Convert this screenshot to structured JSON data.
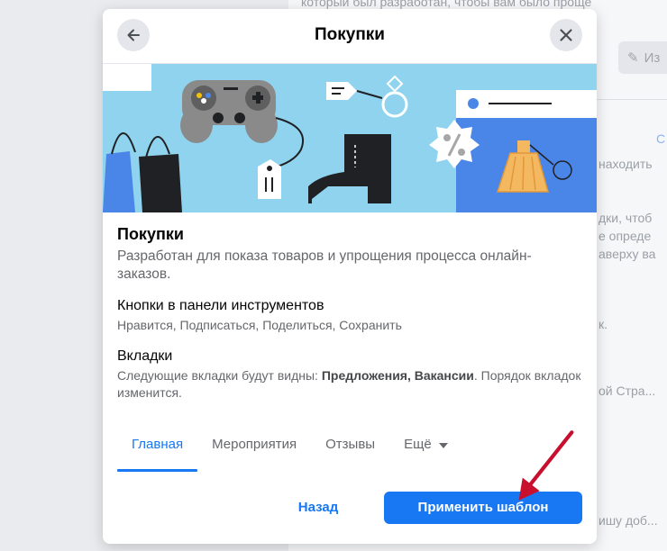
{
  "background": {
    "snippets": [
      "который был разработан, чтобы вам было проще",
      "Из",
      "С",
      "находить",
      "дки, чтоб",
      "е опреде",
      "аверху ва",
      "к.",
      "ой Стра...",
      "ишу доб..."
    ]
  },
  "modal": {
    "title": "Покупки",
    "section_title": "Покупки",
    "section_desc": "Разработан для показа товаров и упрощения процесса онлайн-заказов.",
    "toolbar_title": "Кнопки в панели инструментов",
    "toolbar_desc": "Нравится, Подписаться, Поделиться, Сохранить",
    "tabs_title": "Вкладки",
    "tabs_desc_prefix": "Следующие вкладки будут видны: ",
    "tabs_desc_bold": "Предложения, Вакансии",
    "tabs_desc_suffix": ". Порядок вкладок изменится.",
    "tabs": [
      {
        "label": "Главная",
        "active": true
      },
      {
        "label": "Мероприятия",
        "active": false
      },
      {
        "label": "Отзывы",
        "active": false
      },
      {
        "label": "Ещё",
        "active": false
      }
    ],
    "back_label": "Назад",
    "apply_label": "Применить шаблон"
  },
  "colors": {
    "accent": "#1877f2",
    "banner_sky": "#8fd3ee",
    "banner_blue": "#4a86e8",
    "annotation_arrow": "#c8102e"
  }
}
